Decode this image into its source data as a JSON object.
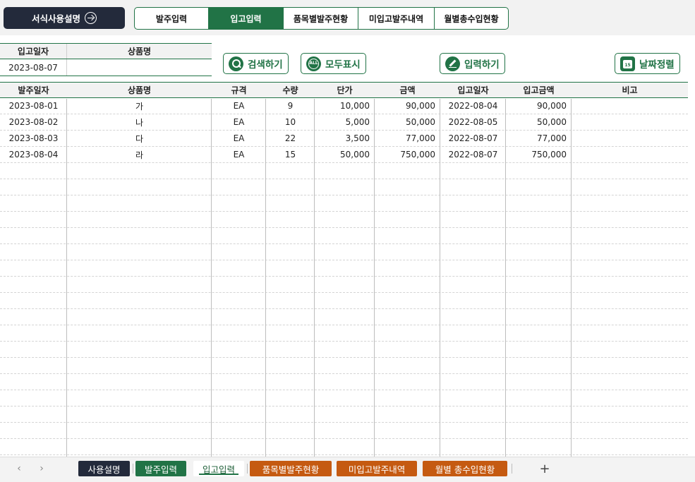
{
  "top": {
    "guide_button": "서식사용설명",
    "tabs": [
      {
        "label": "발주입력",
        "active": false
      },
      {
        "label": "입고입력",
        "active": true
      },
      {
        "label": "품목별발주현황",
        "active": false
      },
      {
        "label": "미입고발주내역",
        "active": false
      },
      {
        "label": "월별총수입현황",
        "active": false
      }
    ]
  },
  "filter": {
    "date_header": "입고일자",
    "product_header": "상품명",
    "date_value": "2023-08-07",
    "product_value": ""
  },
  "actions": {
    "search": "검색하기",
    "show_all": "모두표시",
    "show_all_icon_text": "ALL",
    "input": "입력하기",
    "sort_date": "날짜정렬",
    "calendar_icon_text": "15"
  },
  "grid": {
    "headers": [
      "발주일자",
      "상품명",
      "규격",
      "수량",
      "단가",
      "금액",
      "입고일자",
      "입고금액",
      "비고"
    ],
    "rows": [
      [
        "2023-08-01",
        "가",
        "EA",
        "9",
        "10,000",
        "90,000",
        "2022-08-04",
        "90,000",
        ""
      ],
      [
        "2023-08-02",
        "나",
        "EA",
        "10",
        "5,000",
        "50,000",
        "2022-08-05",
        "50,000",
        ""
      ],
      [
        "2023-08-03",
        "다",
        "EA",
        "22",
        "3,500",
        "77,000",
        "2022-08-07",
        "77,000",
        ""
      ],
      [
        "2023-08-04",
        "라",
        "EA",
        "15",
        "50,000",
        "750,000",
        "2022-08-07",
        "750,000",
        ""
      ]
    ]
  },
  "sheets": {
    "tabs": [
      {
        "label": "사용설명",
        "style": "dark"
      },
      {
        "label": "발주입력",
        "style": "green"
      },
      {
        "label": "입고입력",
        "style": "current"
      },
      {
        "label": "품목별발주현황",
        "style": "orange"
      },
      {
        "label": "미입고발주내역",
        "style": "orange"
      },
      {
        "label": "월별 총수입현황",
        "style": "orange"
      }
    ],
    "add": "+",
    "prev": "‹",
    "next": "›"
  },
  "colors": {
    "accent": "#217346",
    "dark": "#232a3b",
    "orange": "#c55a11"
  }
}
